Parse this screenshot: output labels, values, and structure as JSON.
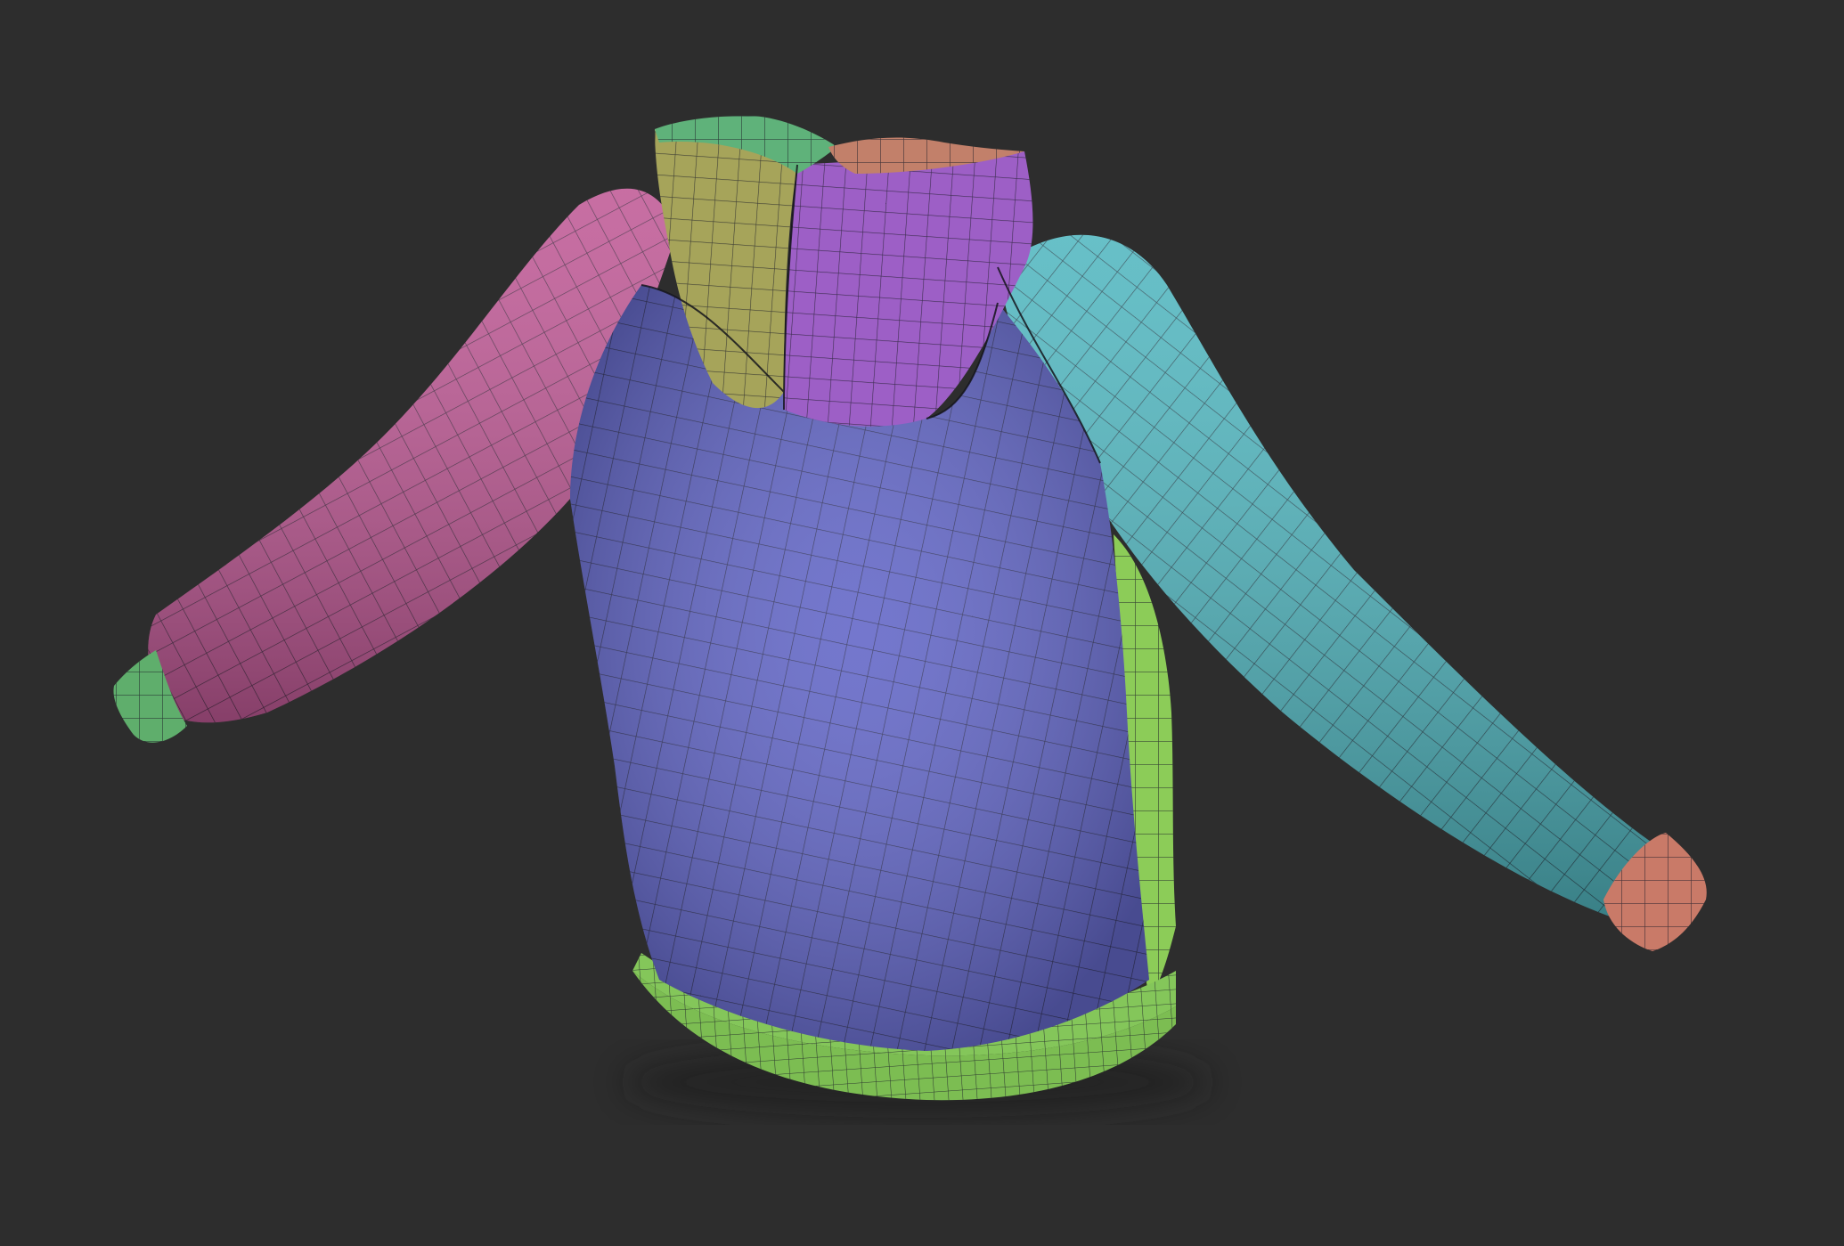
{
  "scene": {
    "background_color": "#2d2d2d",
    "subject": "hoodie-mesh",
    "polygroups": [
      {
        "part": "torso-back",
        "color": "#6468c8"
      },
      {
        "part": "left-sleeve",
        "color": "#c05a96"
      },
      {
        "part": "right-sleeve",
        "color": "#52b7c0"
      },
      {
        "part": "left-cuff",
        "color": "#5fae6c"
      },
      {
        "part": "right-cuff",
        "color": "#c97a68"
      },
      {
        "part": "waistband",
        "color": "#84c65a"
      },
      {
        "part": "side-panel",
        "color": "#8ccc58"
      },
      {
        "part": "hood-right",
        "color": "#9d5fc6"
      },
      {
        "part": "hood-left",
        "color": "#a6a45a"
      },
      {
        "part": "hood-top-green",
        "color": "#5fb27a"
      },
      {
        "part": "hood-top-orange",
        "color": "#c2806a"
      }
    ],
    "wire_color": "#1c1c28"
  }
}
